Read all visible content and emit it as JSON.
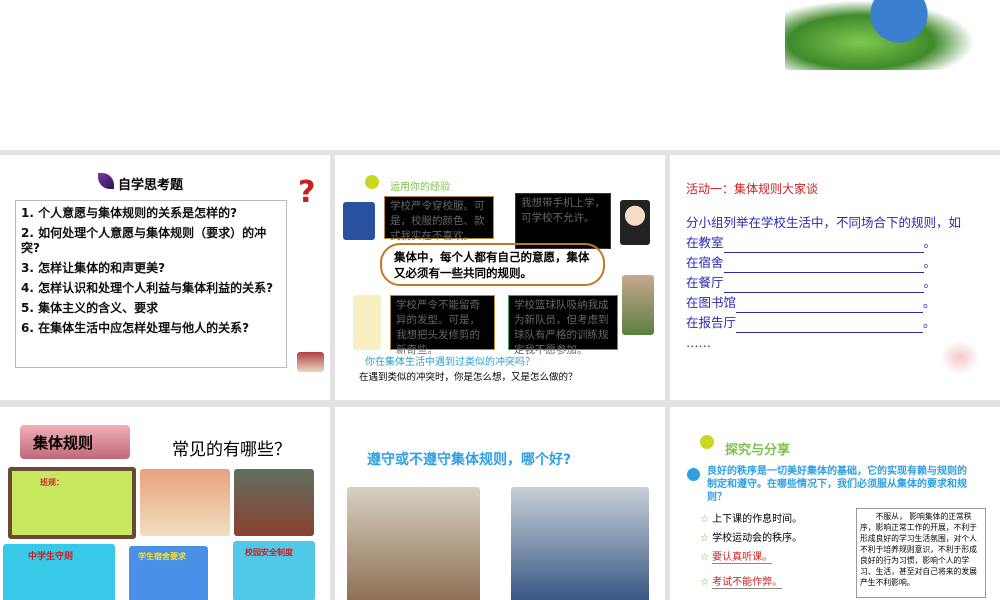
{
  "slide1": {
    "title": "自学思考题",
    "questions": [
      "1. 个人意愿与集体规则的关系是怎样的?",
      "2. 如何处理个人意愿与集体规则（要求）的冲突?",
      "3. 怎样让集体的和声更美?",
      "4. 怎样认识和处理个人利益与集体利益的关系?",
      "5. 集体主义的含义、要求",
      "6. 在集体生活中应怎样处理与他人的关系?"
    ]
  },
  "slide2": {
    "title": "运用你的经验",
    "bubble1": "学校严令穿校服。可是，校服的颜色、款式我实在不喜欢。",
    "bubble2": "我想带手机上学，可学校不允许。",
    "center": "集体中，每个人都有自己的意愿，集体又必须有一些共同的规则。",
    "bubble3": "学校严令不能留奇异的发型。可是，我想把头发修剪的新奇些。",
    "bubble4": "学校篮球队吸纳我成为新队员，但考虑到球队有严格的训练规定我不愿参加。",
    "question": "你在集体生活中遇到过类似的冲突吗？",
    "question2": "在遇到类似的冲突时，你是怎么想，又是怎么做的？"
  },
  "slide3": {
    "title": "活动一：集体规则大家谈",
    "intro": "分小组列举在学校生活中，不同场合下的规则，如",
    "places": [
      "在教室",
      "在宿舍",
      "在餐厅",
      "在图书馆",
      "在报告厅"
    ],
    "period": "。",
    "ellipsis": "……"
  },
  "slide4": {
    "banner": "集体规则",
    "heading": "常见的有哪些？",
    "board": "班规：",
    "poster1": "中学生守则",
    "poster2": "学生宿舍要求",
    "poster3": "校园安全制度"
  },
  "slide5": {
    "title": "遵守或不遵守集体规则，哪个好?"
  },
  "slide6": {
    "title": "探究与分享",
    "question": "良好的秩序是一切美好集体的基础，它的实现有赖与规则的制定和遵守。在哪些情况下，我们必须服从集体的要求和规则？",
    "items": [
      "上下课的作息时间。",
      "学校运动会的秩序。",
      "要认真听课。",
      "考试不能作弊。"
    ],
    "note": "不服从， 影响集体的正常秩序，影响正常工作的开展，不利于形成良好的学习生活氛围，对个人不利于培养规则意识，不利于形成良好的行为习惯，影响个人的学习、生活，甚至对自己将来的发展产生不利影响。"
  }
}
